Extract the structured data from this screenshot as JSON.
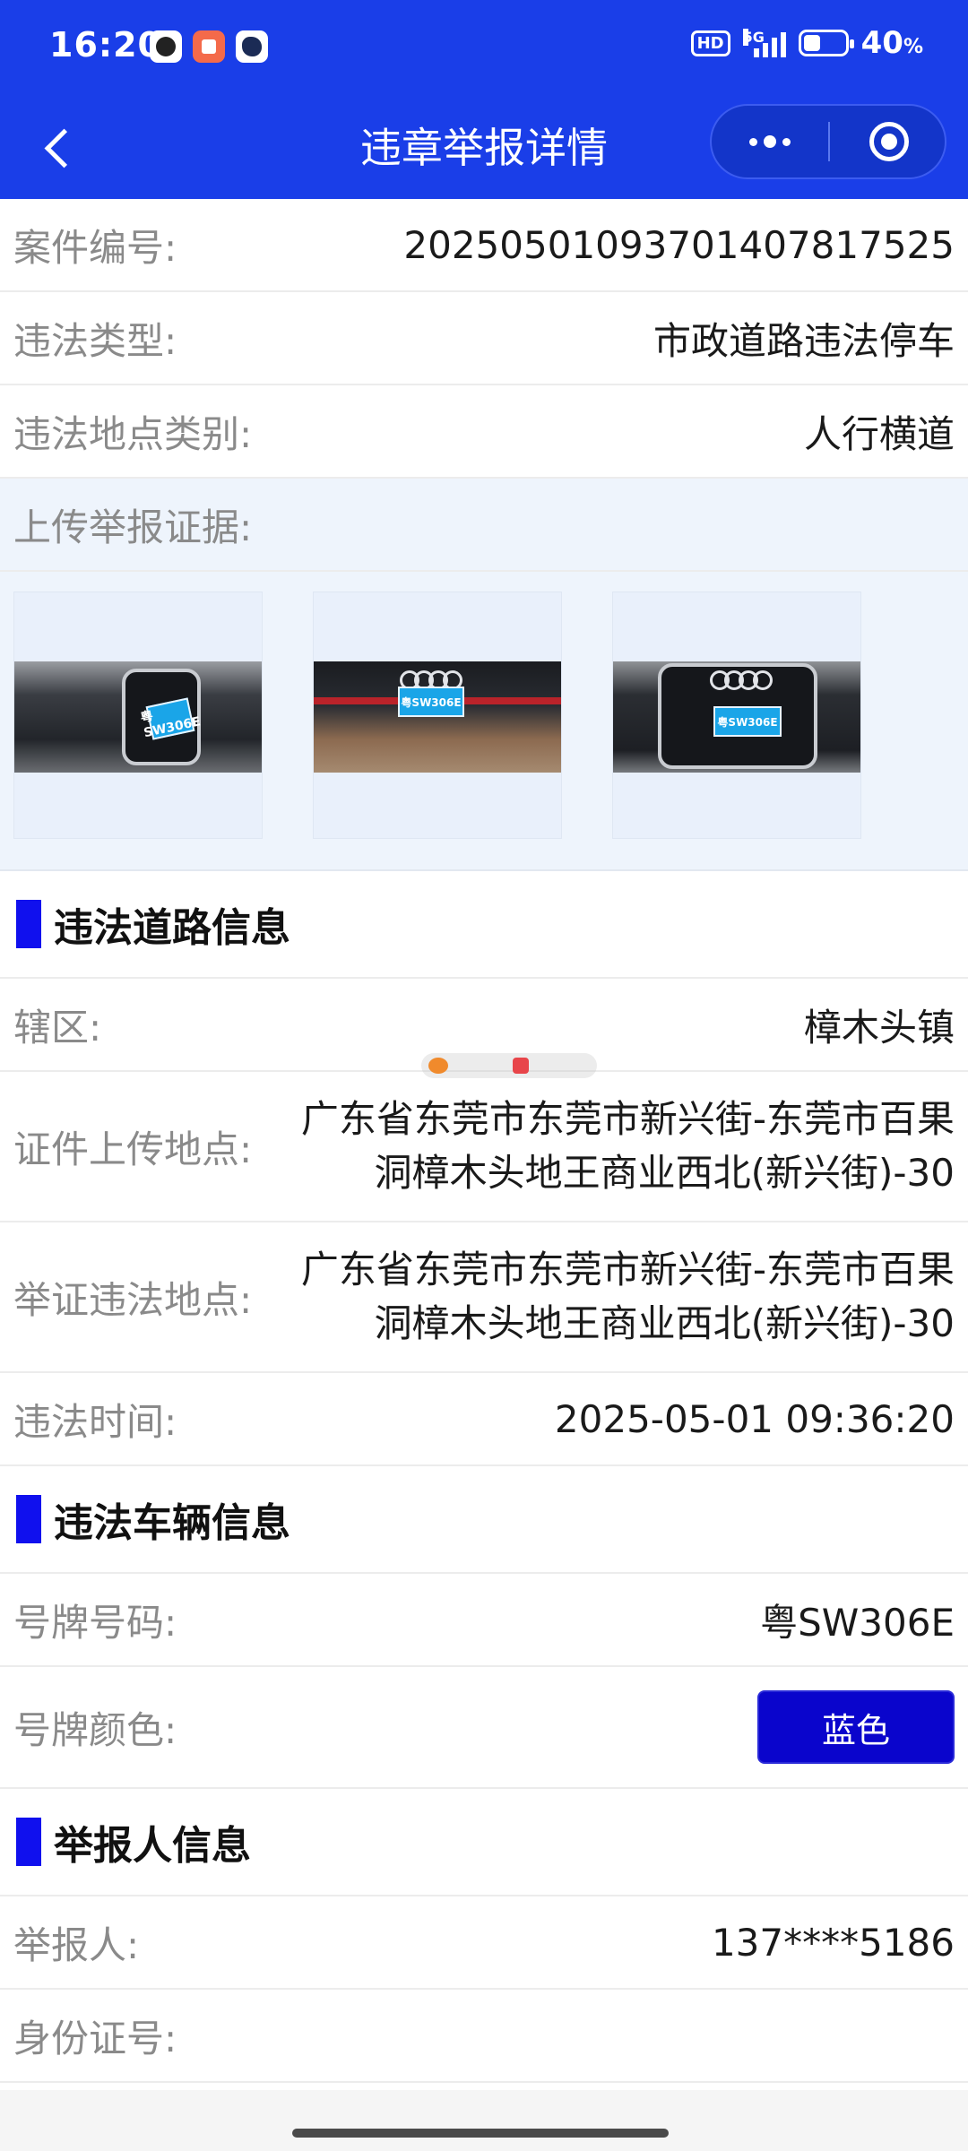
{
  "status_bar": {
    "time": "16:20",
    "hd": "HD",
    "network": "5G",
    "battery_percent": "40",
    "battery_unit": "%",
    "battery_level": 0.4
  },
  "header": {
    "title": "违章举报详情",
    "back_icon": "chevron-left-icon",
    "more_icon": "more-dots-icon",
    "close_icon": "target-circle-icon",
    "background": "#1a3ee8"
  },
  "case": {
    "case_no_label": "案件编号:",
    "case_no_value": "20250501093701407817525",
    "type_label": "违法类型:",
    "type_value": "市政道路违法停车",
    "place_type_label": "违法地点类别:",
    "place_type_value": "人行横道",
    "evidence_label": "上传举报证据:",
    "evidence_photos": [
      {
        "plate": "粤SW306E"
      },
      {
        "plate": "粤SW306E"
      },
      {
        "plate": "粤SW306E"
      }
    ]
  },
  "road_section": {
    "title": "违法道路信息",
    "district_label": "辖区:",
    "district_value": "樟木头镇",
    "upload_place_label": "证件上传地点:",
    "upload_place_value": "广东省东莞市东莞市新兴街-东莞市百果洞樟木头地王商业西北(新兴街)-30",
    "evidence_place_label": "举证违法地点:",
    "evidence_place_value": "广东省东莞市东莞市新兴街-东莞市百果洞樟木头地王商业西北(新兴街)-30",
    "time_label": "违法时间:",
    "time_value": "2025-05-01 09:36:20"
  },
  "vehicle_section": {
    "title": "违法车辆信息",
    "plate_label": "号牌号码:",
    "plate_value": "粤SW306E",
    "color_label": "号牌颜色:",
    "color_value": "蓝色",
    "color_badge": "#0a05cc"
  },
  "reporter_section": {
    "title": "举报人信息",
    "reporter_label": "举报人:",
    "reporter_value": "137****5186",
    "id_label": "身份证号:",
    "id_value": ""
  },
  "accent_color": "#1010ee"
}
